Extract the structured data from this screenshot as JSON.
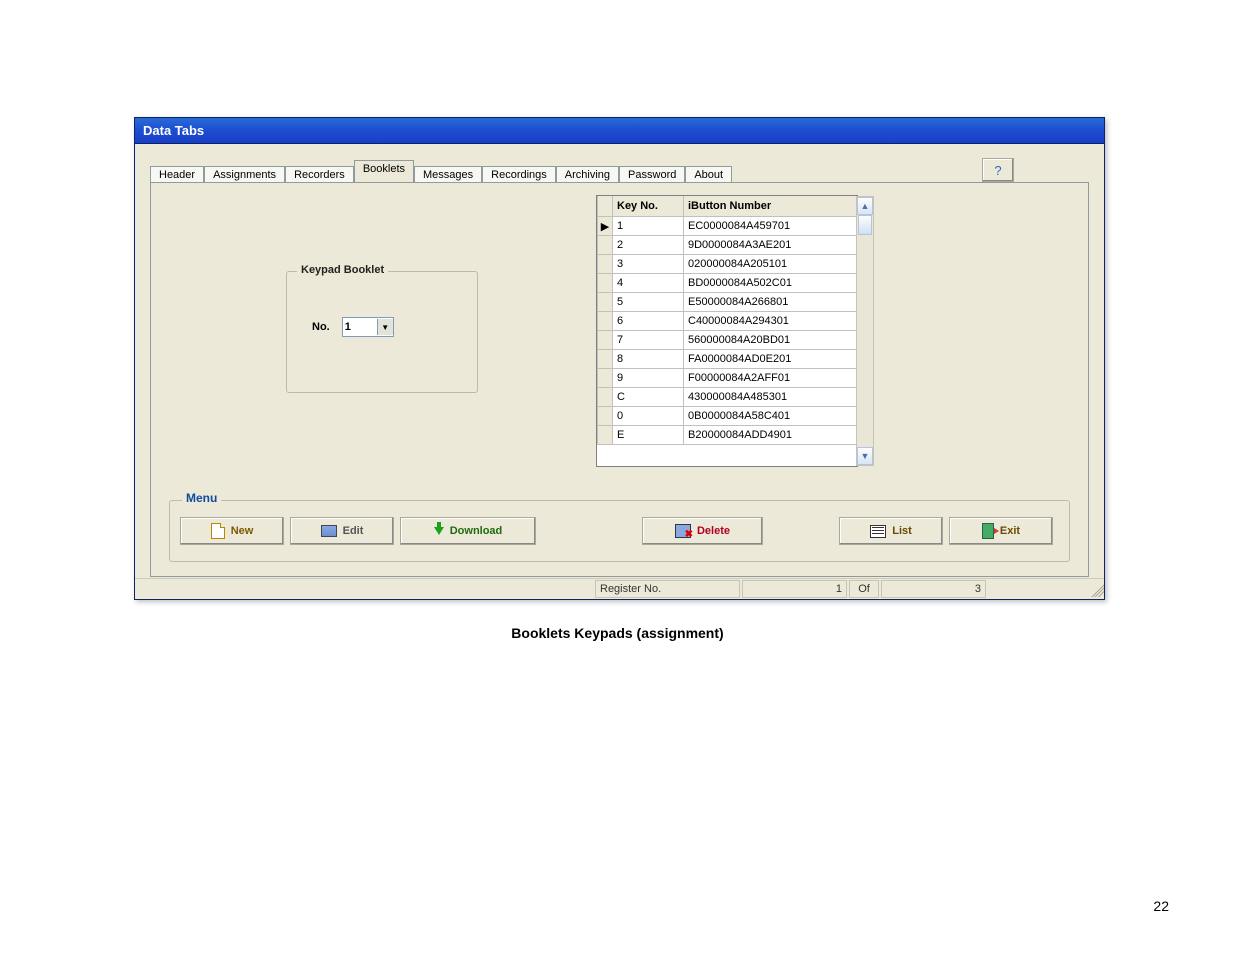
{
  "window": {
    "title": "Data Tabs"
  },
  "tabs": {
    "items": [
      "Header",
      "Assignments",
      "Recorders",
      "Booklets",
      "Messages",
      "Recordings",
      "Archiving",
      "Password",
      "About"
    ],
    "active_index": 3
  },
  "help_btn": "?",
  "booklet": {
    "legend": "Keypad Booklet",
    "no_label": "No.",
    "no_value": "1"
  },
  "grid": {
    "headers": {
      "key_no": "Key No.",
      "ibutton": "iButton Number"
    },
    "rows": [
      {
        "key": "1",
        "ibutton": "EC0000084A459701",
        "current": true
      },
      {
        "key": "2",
        "ibutton": "9D0000084A3AE201"
      },
      {
        "key": "3",
        "ibutton": "020000084A205101"
      },
      {
        "key": "4",
        "ibutton": "BD0000084A502C01"
      },
      {
        "key": "5",
        "ibutton": "E50000084A266801"
      },
      {
        "key": "6",
        "ibutton": "C40000084A294301"
      },
      {
        "key": "7",
        "ibutton": "560000084A20BD01"
      },
      {
        "key": "8",
        "ibutton": "FA0000084AD0E201"
      },
      {
        "key": "9",
        "ibutton": "F00000084A2AFF01"
      },
      {
        "key": "C",
        "ibutton": "430000084A485301"
      },
      {
        "key": "0",
        "ibutton": "0B0000084A58C401"
      },
      {
        "key": "E",
        "ibutton": "B20000084ADD4901"
      }
    ]
  },
  "menu": {
    "legend": "Menu",
    "new": "New",
    "edit": "Edit",
    "download": "Download",
    "delete": "Delete",
    "list": "List",
    "exit": "Exit"
  },
  "status": {
    "register_label": "Register No.",
    "register_value": "1",
    "of_label": "Of",
    "total": "3"
  },
  "caption": "Booklets Keypads (assignment)",
  "page_number": "22"
}
